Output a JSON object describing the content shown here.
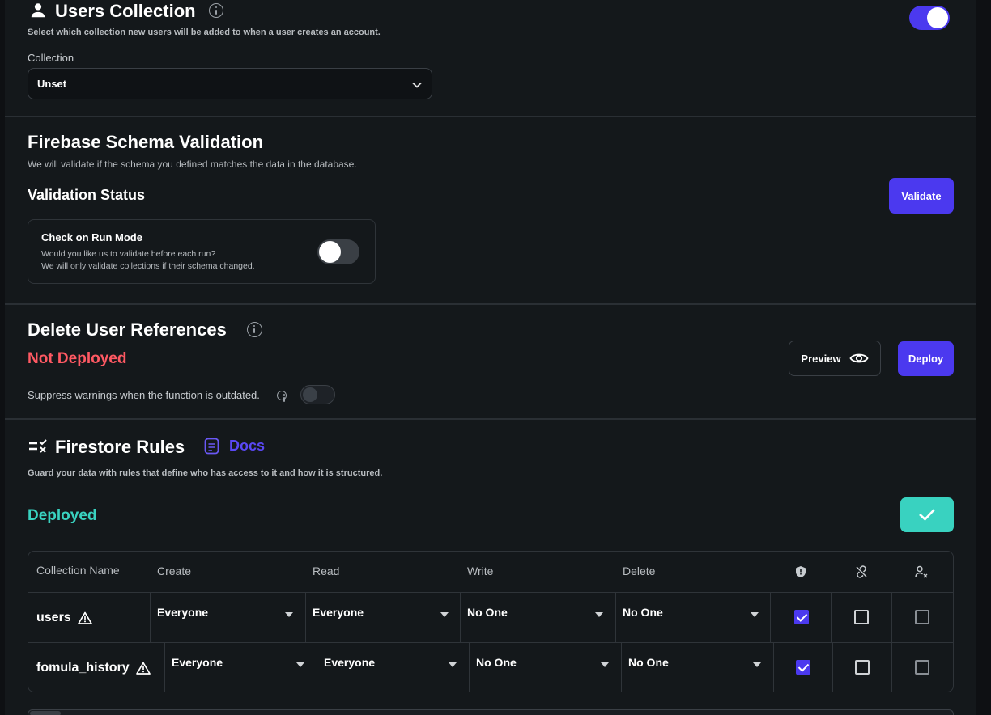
{
  "users_collection": {
    "title": "Users Collection",
    "description": "Select which collection new users will be added to when a user creates an account.",
    "enabled": true,
    "collection_label": "Collection",
    "collection_value": "Unset"
  },
  "schema_validation": {
    "title": "Firebase Schema Validation",
    "description": "We will validate if the schema you defined matches the data in the database.",
    "status_title": "Validation Status",
    "validate_label": "Validate",
    "run_mode": {
      "title": "Check on Run Mode",
      "line1": "Would you like us to validate before each run?",
      "line2": "We will only validate collections if their schema changed.",
      "enabled": false
    }
  },
  "delete_user_refs": {
    "title": "Delete User References",
    "status": "Not Deployed",
    "suppress_label": "Suppress warnings when the function is outdated.",
    "suppress_enabled": false,
    "preview_label": "Preview",
    "deploy_label": "Deploy"
  },
  "firestore_rules": {
    "title": "Firestore Rules",
    "docs_label": "Docs",
    "description": "Guard your data with rules that define who has access to it and how it is structured.",
    "status": "Deployed",
    "table": {
      "headers": [
        "Collection Name",
        "Create",
        "Read",
        "Write",
        "Delete"
      ],
      "rows": [
        {
          "name": "users",
          "create": "Everyone",
          "read": "Everyone",
          "write": "No One",
          "delete": "No One"
        },
        {
          "name": "fomula_history",
          "create": "Everyone",
          "read": "Everyone",
          "write": "No One",
          "delete": "No One"
        }
      ]
    }
  },
  "colors": {
    "accent": "#4b39ef",
    "error": "#ff5963",
    "success": "#39d2c0",
    "background": "#14181b"
  }
}
